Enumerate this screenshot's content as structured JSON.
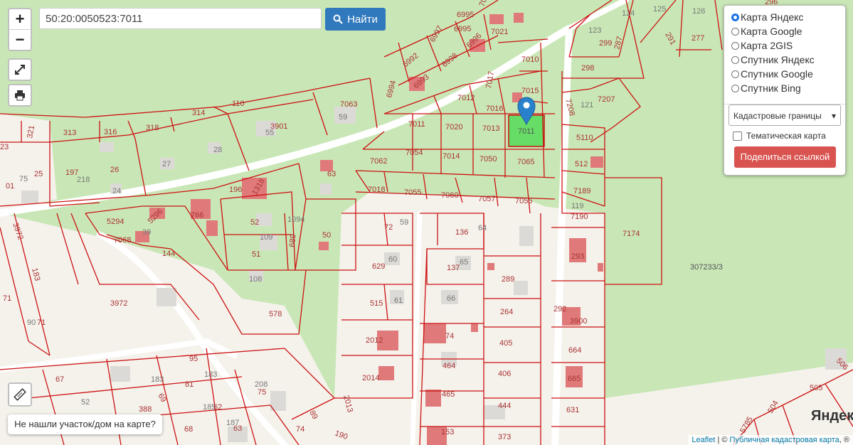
{
  "search": {
    "value": "50:20:0050523:7011",
    "button": "Найти"
  },
  "zoom": {
    "in": "+",
    "out": "−"
  },
  "layers": {
    "options": [
      "Карта Яндекс",
      "Карта Google",
      "Карта 2GIS",
      "Спутник Яндекс",
      "Спутник Google",
      "Спутник Bing"
    ],
    "selected_index": 0,
    "overlay_select": "Кадастровые границы",
    "thematic_label": "Тематическая карта",
    "thematic_checked": false,
    "share_button": "Поделиться ссылкой"
  },
  "not_found": "Не нашли участок/дом на карте?",
  "attribution": {
    "leaflet": "Leaflet",
    "separator": " | © ",
    "source": "Публичная кадастровая карта",
    "suffix": ", ®"
  },
  "logo": "Яндекс",
  "selected_parcel": "7011",
  "colors": {
    "boundary": "#cc1111",
    "selected_fill": "#66dd66",
    "marker": "#2a81cb",
    "button_blue": "#3079bd",
    "share_red": "#d9534f"
  },
  "icons": [
    "fullscreen-icon",
    "print-icon",
    "search-icon",
    "ruler-icon",
    "map-marker-icon"
  ],
  "parcel_labels": [
    "6995",
    "7021",
    "6997",
    "6995",
    "6996",
    "7021",
    "6992",
    "6998",
    "6993",
    "7010",
    "6994",
    "7017",
    "7015",
    "7012",
    "7016",
    "7011",
    "7020",
    "7013",
    "7054",
    "7014",
    "7050",
    "7065",
    "7062",
    "7018",
    "7055",
    "7060",
    "7057",
    "7056",
    "7063",
    "59",
    "110",
    "314",
    "318",
    "316",
    "313",
    "321",
    "3901",
    "55",
    "28",
    "27",
    "26",
    "197",
    "218",
    "24",
    "25",
    "75",
    "23",
    "01",
    "63",
    "196",
    "1318",
    "766",
    "5294",
    "5296",
    "7068",
    "39",
    "52",
    "109",
    "1094",
    "50",
    "689",
    "51",
    "108",
    "144",
    "3972",
    "183",
    "71",
    "3972",
    "90",
    "71",
    "578",
    "72",
    "59",
    "136",
    "64",
    "629",
    "60",
    "137",
    "65",
    "289",
    "515",
    "61",
    "66",
    "264",
    "2012",
    "74",
    "405",
    "2014",
    "464",
    "406",
    "465",
    "444",
    "153",
    "373",
    "2013",
    "95",
    "183",
    "183",
    "81",
    "67",
    "69",
    "208",
    "75",
    "388",
    "185",
    "62",
    "187",
    "63",
    "74",
    "68",
    "89",
    "190",
    "52",
    "124",
    "125",
    "126",
    "123",
    "299",
    "287",
    "291",
    "277",
    "296",
    "298",
    "7207",
    "7208",
    "121",
    "5110",
    "512",
    "7189",
    "7190",
    "119",
    "7174",
    "293",
    "307233/3",
    "292",
    "3900",
    "664",
    "665",
    "631",
    "505",
    "504",
    "5785",
    "506"
  ]
}
